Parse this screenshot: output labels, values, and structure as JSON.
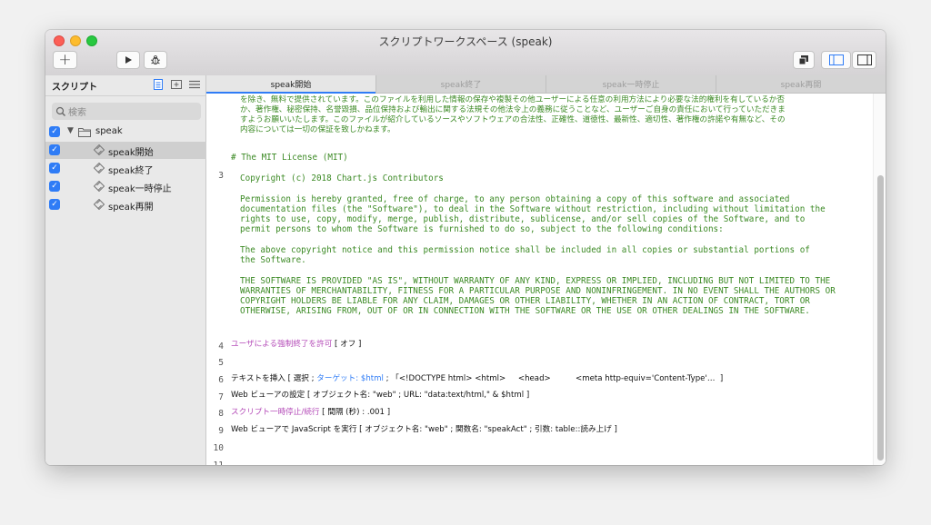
{
  "window": {
    "title": "スクリプトワークスペース (speak)"
  },
  "toolbar": {
    "add_label": "+",
    "run_icon": "play-icon",
    "debug_icon": "bug-icon"
  },
  "sidebar": {
    "header": "スクリプト",
    "search_placeholder": "検索",
    "folder": "speak",
    "items": [
      {
        "label": "speak開始",
        "selected": true
      },
      {
        "label": "speak終了",
        "selected": false
      },
      {
        "label": "speak一時停止",
        "selected": false
      },
      {
        "label": "speak再開",
        "selected": false
      }
    ]
  },
  "tabs": [
    "speak開始",
    "speak終了",
    "speak一時停止",
    "speak再開"
  ],
  "editor": {
    "line_numbers": [
      "3",
      "4",
      "5",
      "6",
      "7",
      "8",
      "9",
      "10",
      "11",
      "12"
    ],
    "comment_top": [
      "を除き、無料で提供されています。このファイルを利用した情報の保存や複製その他ユーザーによる任意の利用方法により必要な法的権利を有しているか否",
      "か、著作権、秘密保持、名誉毀損、品位保持および輸出に関する法規その他法令上の義務に従うことなど、ユーザーご自身の責任において行っていただきま",
      "すようお願いいたします。このファイルが紹介しているソースやソフトウェアの合法性、正確性、道徳性、最新性、適切性、著作権の許諾や有無など、その",
      "内容については一切の保証を致しかねます。"
    ],
    "license_title": "# The MIT License (MIT)",
    "copyright": "Copyright (c) 2018 Chart.js Contributors",
    "permission": [
      "Permission is hereby granted, free of charge, to any person obtaining a copy of this software and associated",
      "documentation files (the \"Software\"), to deal in the Software without restriction, including without limitation the",
      "rights to use, copy, modify, merge, publish, distribute, sublicense, and/or sell copies of the Software, and to",
      "permit persons to whom the Software is furnished to do so, subject to the following conditions:"
    ],
    "notice": [
      "The above copyright notice and this permission notice shall be included in all copies or substantial portions of",
      "the Software."
    ],
    "warranty": [
      "THE SOFTWARE IS PROVIDED \"AS IS\", WITHOUT WARRANTY OF ANY KIND, EXPRESS OR IMPLIED, INCLUDING BUT NOT LIMITED TO THE",
      "WARRANTIES OF MERCHANTABILITY, FITNESS FOR A PARTICULAR PURPOSE AND NONINFRINGEMENT. IN NO EVENT SHALL THE AUTHORS OR",
      "COPYRIGHT HOLDERS BE LIABLE FOR ANY CLAIM, DAMAGES OR OTHER LIABILITY, WHETHER IN AN ACTION OF CONTRACT, TORT OR",
      "OTHERWISE, ARISING FROM, OUT OF OR IN CONNECTION WITH THE SOFTWARE OR THE USE OR OTHER DEALINGS IN THE SOFTWARE."
    ],
    "line5_cmd": "ユーザによる強制終了を許可",
    "line5_rest": " [ オフ ]",
    "line7_a": "テキストを挿入 [ 選択 ; ",
    "line7_b": "ターゲット: $html",
    "line7_c": " ; 「<!DOCTYPE html> <html>     <head>          <meta http-equiv='Content-Type'…  ]",
    "line8": "Web ビューアの設定 [ オブジェクト名: \"web\" ; URL: \"data:text/html,\" & $html ]",
    "line9_cmd": "スクリプト一時停止/続行",
    "line9_rest": " [ 間隔 (秒) : .001 ]",
    "line10": "Web ビューアで JavaScript を実行 [ オブジェクト名: \"web\" ; 関数名: \"speakAct\" ; 引数: table::読み上げ ]"
  },
  "colors": {
    "accent": "#2f7cf6",
    "comment": "#3c8a25",
    "script_step": "#b44bb8"
  }
}
